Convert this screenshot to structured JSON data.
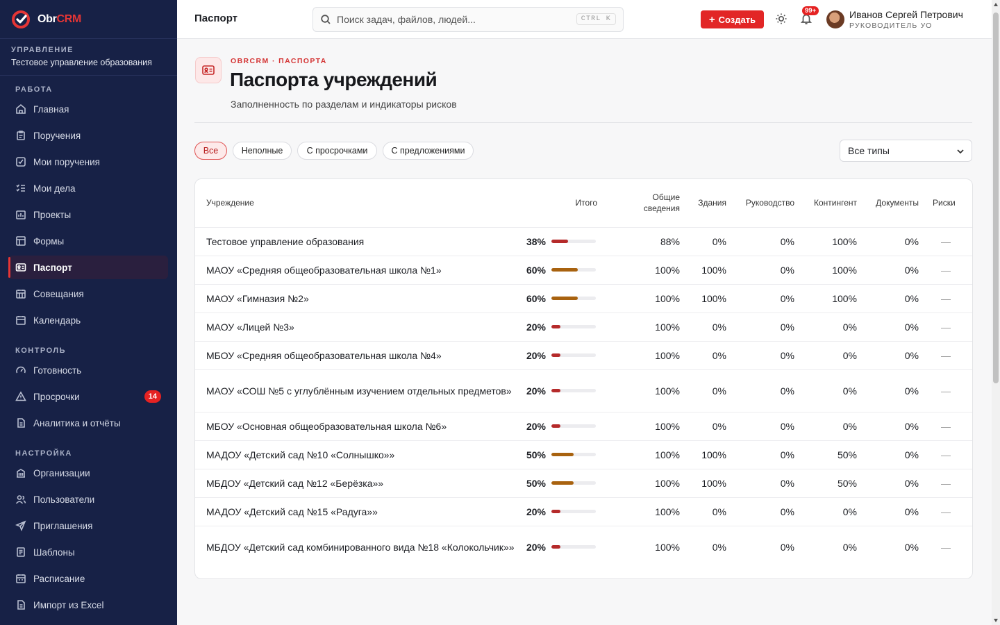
{
  "brand": {
    "name_left": "Obr",
    "name_right": "CRM"
  },
  "org": {
    "caption": "УПРАВЛЕНИЕ",
    "name": "Тестовое управление образования"
  },
  "sidebar": {
    "sections": [
      {
        "title": "РАБОТА"
      },
      {
        "title": "КОНТРОЛЬ"
      },
      {
        "title": "НАСТРОЙКА"
      }
    ],
    "items": [
      {
        "label": "Главная",
        "icon": "home-icon"
      },
      {
        "label": "Поручения",
        "icon": "clipboard-icon"
      },
      {
        "label": "Мои поручения",
        "icon": "checkbox-icon"
      },
      {
        "label": "Мои дела",
        "icon": "list-check-icon"
      },
      {
        "label": "Проекты",
        "icon": "folder-chart-icon"
      },
      {
        "label": "Формы",
        "icon": "form-icon"
      },
      {
        "label": "Паспорт",
        "icon": "id-card-icon",
        "active": true
      },
      {
        "label": "Совещания",
        "icon": "calendar-grid-icon"
      },
      {
        "label": "Календарь",
        "icon": "calendar-icon"
      },
      {
        "label": "Готовность",
        "icon": "gauge-icon"
      },
      {
        "label": "Просрочки",
        "icon": "warning-icon",
        "badge": "14"
      },
      {
        "label": "Аналитика и отчёты",
        "icon": "report-icon"
      },
      {
        "label": "Организации",
        "icon": "building-icon"
      },
      {
        "label": "Пользователи",
        "icon": "users-icon"
      },
      {
        "label": "Приглашения",
        "icon": "send-icon"
      },
      {
        "label": "Шаблоны",
        "icon": "template-icon"
      },
      {
        "label": "Расписание",
        "icon": "schedule-icon"
      },
      {
        "label": "Импорт из Excel",
        "icon": "import-icon"
      }
    ]
  },
  "topbar": {
    "title": "Паспорт",
    "search_placeholder": "Поиск задач, файлов, людей...",
    "search_shortcut": "CTRL K",
    "create_label": "Создать",
    "notifications_badge": "99+",
    "user_name": "Иванов Сергей Петрович",
    "user_role": "РУКОВОДИТЕЛЬ УО"
  },
  "page": {
    "breadcrumb": "OBRCRM · ПАСПОРТА",
    "title": "Паспорта учреждений",
    "subtitle": "Заполненность по разделам и индикаторы рисков"
  },
  "filters": {
    "chips": [
      "Все",
      "Неполные",
      "С просрочками",
      "С предложениями"
    ],
    "active_chip": 0,
    "type_select": "Все типы"
  },
  "colors": {
    "accent": "#e22626",
    "bar_low": "#b52a2a",
    "bar_mid": "#a8620f"
  },
  "table": {
    "headers": {
      "name": "Учреждение",
      "total": "Итого",
      "general_1": "Общие",
      "general_2": "сведения",
      "buildings": "Здания",
      "management": "Руководство",
      "contingent": "Контингент",
      "documents": "Документы",
      "risks": "Риски"
    },
    "rows": [
      {
        "name": "Тестовое управление образования",
        "total": "38%",
        "total_pct": 38,
        "general": "88%",
        "buildings": "0%",
        "management": "0%",
        "contingent": "100%",
        "documents": "0%",
        "risks": "—"
      },
      {
        "name": "МАОУ «Средняя общеобразовательная школа №1»",
        "total": "60%",
        "total_pct": 60,
        "general": "100%",
        "buildings": "100%",
        "management": "0%",
        "contingent": "100%",
        "documents": "0%",
        "risks": "—"
      },
      {
        "name": "МАОУ «Гимназия №2»",
        "total": "60%",
        "total_pct": 60,
        "general": "100%",
        "buildings": "100%",
        "management": "0%",
        "contingent": "100%",
        "documents": "0%",
        "risks": "—"
      },
      {
        "name": "МАОУ «Лицей №3»",
        "total": "20%",
        "total_pct": 20,
        "general": "100%",
        "buildings": "0%",
        "management": "0%",
        "contingent": "0%",
        "documents": "0%",
        "risks": "—"
      },
      {
        "name": "МБОУ «Средняя общеобразовательная школа №4»",
        "total": "20%",
        "total_pct": 20,
        "general": "100%",
        "buildings": "0%",
        "management": "0%",
        "contingent": "0%",
        "documents": "0%",
        "risks": "—"
      },
      {
        "name": "МАОУ «СОШ №5 с углублённым изучением отдельных предметов»",
        "total": "20%",
        "total_pct": 20,
        "general": "100%",
        "buildings": "0%",
        "management": "0%",
        "contingent": "0%",
        "documents": "0%",
        "risks": "—"
      },
      {
        "name": "МБОУ «Основная общеобразовательная школа №6»",
        "total": "20%",
        "total_pct": 20,
        "general": "100%",
        "buildings": "0%",
        "management": "0%",
        "contingent": "0%",
        "documents": "0%",
        "risks": "—"
      },
      {
        "name": "МАДОУ «Детский сад №10 «Солнышко»»",
        "total": "50%",
        "total_pct": 50,
        "general": "100%",
        "buildings": "100%",
        "management": "0%",
        "contingent": "50%",
        "documents": "0%",
        "risks": "—"
      },
      {
        "name": "МБДОУ «Детский сад №12 «Берёзка»»",
        "total": "50%",
        "total_pct": 50,
        "general": "100%",
        "buildings": "100%",
        "management": "0%",
        "contingent": "50%",
        "documents": "0%",
        "risks": "—"
      },
      {
        "name": "МАДОУ «Детский сад №15 «Радуга»»",
        "total": "20%",
        "total_pct": 20,
        "general": "100%",
        "buildings": "0%",
        "management": "0%",
        "contingent": "0%",
        "documents": "0%",
        "risks": "—"
      },
      {
        "name": "МБДОУ «Детский сад комбинированного вида №18 «Колокольчик»»",
        "total": "20%",
        "total_pct": 20,
        "general": "100%",
        "buildings": "0%",
        "management": "0%",
        "contingent": "0%",
        "documents": "0%",
        "risks": "—"
      }
    ]
  }
}
